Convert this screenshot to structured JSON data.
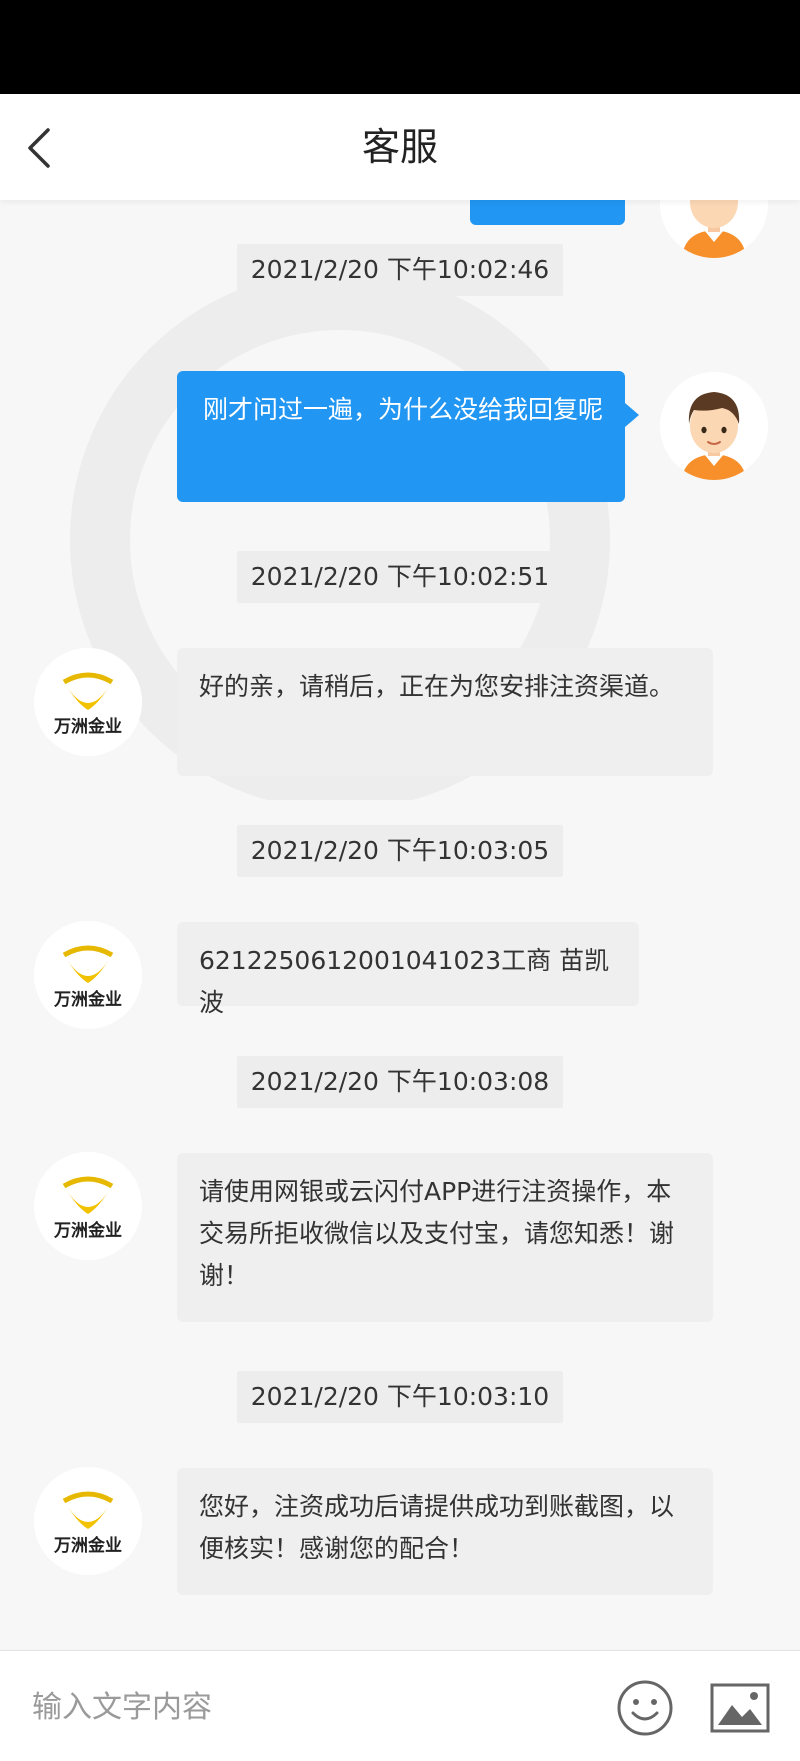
{
  "header": {
    "title": "客服"
  },
  "agent_logo_text": "万洲金业",
  "messages": [
    {
      "time": "2021/2/20 下午10:02:46",
      "text": "刚才问过一遍，为什么没给我回复呢"
    },
    {
      "time": "2021/2/20 下午10:02:51",
      "text": "好的亲，请稍后，正在为您安排注资渠道。"
    },
    {
      "time": "2021/2/20 下午10:03:05",
      "text": "6212250612001041023工商 苗凯波"
    },
    {
      "time": "2021/2/20 下午10:03:08",
      "text": "请使用网银或云闪付APP进行注资操作，本交易所拒收微信以及支付宝，请您知悉！谢谢！"
    },
    {
      "time": "2021/2/20 下午10:03:10",
      "text": "您好，注资成功后请提供成功到账截图，以便核实！感谢您的配合！"
    }
  ],
  "input": {
    "placeholder": "输入文字内容",
    "value": ""
  },
  "icons": {
    "back": "chevron-left-icon",
    "emoji": "smiley-icon",
    "image": "image-icon"
  },
  "colors": {
    "user_bubble": "#2196f3",
    "agent_bubble": "#efefef",
    "logo_gold": "#e6b800"
  }
}
